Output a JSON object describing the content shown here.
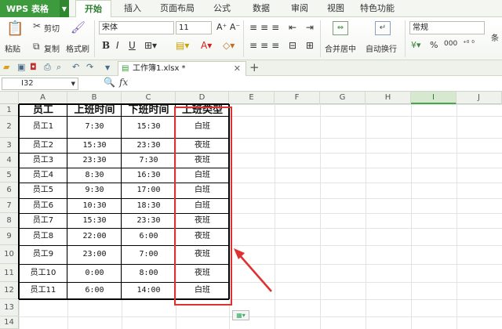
{
  "app": {
    "name": "WPS 表格"
  },
  "tabs": [
    "开始",
    "插入",
    "页面布局",
    "公式",
    "数据",
    "审阅",
    "视图",
    "特色功能"
  ],
  "active_tab": 0,
  "ribbon": {
    "paste": "粘贴",
    "cut": "剪切",
    "copy": "复制",
    "format_painter": "格式刷",
    "font_name": "宋体",
    "font_size": "11",
    "bold": "B",
    "italic": "I",
    "underline": "U",
    "merge_center": "合并居中",
    "auto_wrap": "自动换行",
    "number_format": "常规",
    "percent": "%",
    "comma": "000",
    "more": "条"
  },
  "document": {
    "tab_name": "工作簿1.xlsx *"
  },
  "formula": {
    "name_box": "I32",
    "fx": "fx",
    "content": ""
  },
  "columns": [
    "A",
    "B",
    "C",
    "D",
    "E",
    "F",
    "G",
    "H",
    "I",
    "J"
  ],
  "selected_column": "I",
  "rows": [
    "1",
    "2",
    "3",
    "4",
    "5",
    "6",
    "7",
    "8",
    "9",
    "10",
    "11",
    "12",
    "13",
    "14"
  ],
  "table": {
    "headers": [
      "员工",
      "上班时间",
      "下班时间",
      "上班类型"
    ],
    "rows": [
      [
        "员工1",
        "7:30",
        "15:30",
        "白班"
      ],
      [
        "员工2",
        "15:30",
        "23:30",
        "夜班"
      ],
      [
        "员工3",
        "23:30",
        "7:30",
        "夜班"
      ],
      [
        "员工4",
        "8:30",
        "16:30",
        "白班"
      ],
      [
        "员工5",
        "9:30",
        "17:00",
        "白班"
      ],
      [
        "员工6",
        "10:30",
        "18:30",
        "白班"
      ],
      [
        "员工7",
        "15:30",
        "23:30",
        "夜班"
      ],
      [
        "员工8",
        "22:00",
        "6:00",
        "夜班"
      ],
      [
        "员工9",
        "23:00",
        "7:00",
        "夜班"
      ],
      [
        "员工10",
        "0:00",
        "8:00",
        "夜班"
      ],
      [
        "员工11",
        "6:00",
        "14:00",
        "白班"
      ]
    ]
  },
  "colors": {
    "accent": "#3d9a3d",
    "highlight_border": "#e03030",
    "arrow": "#e03030"
  },
  "icons": [
    "paste-icon",
    "scissors-icon",
    "copy-icon",
    "brush-icon",
    "fx-icon",
    "zoom-icon",
    "arrow-annotation-icon"
  ]
}
